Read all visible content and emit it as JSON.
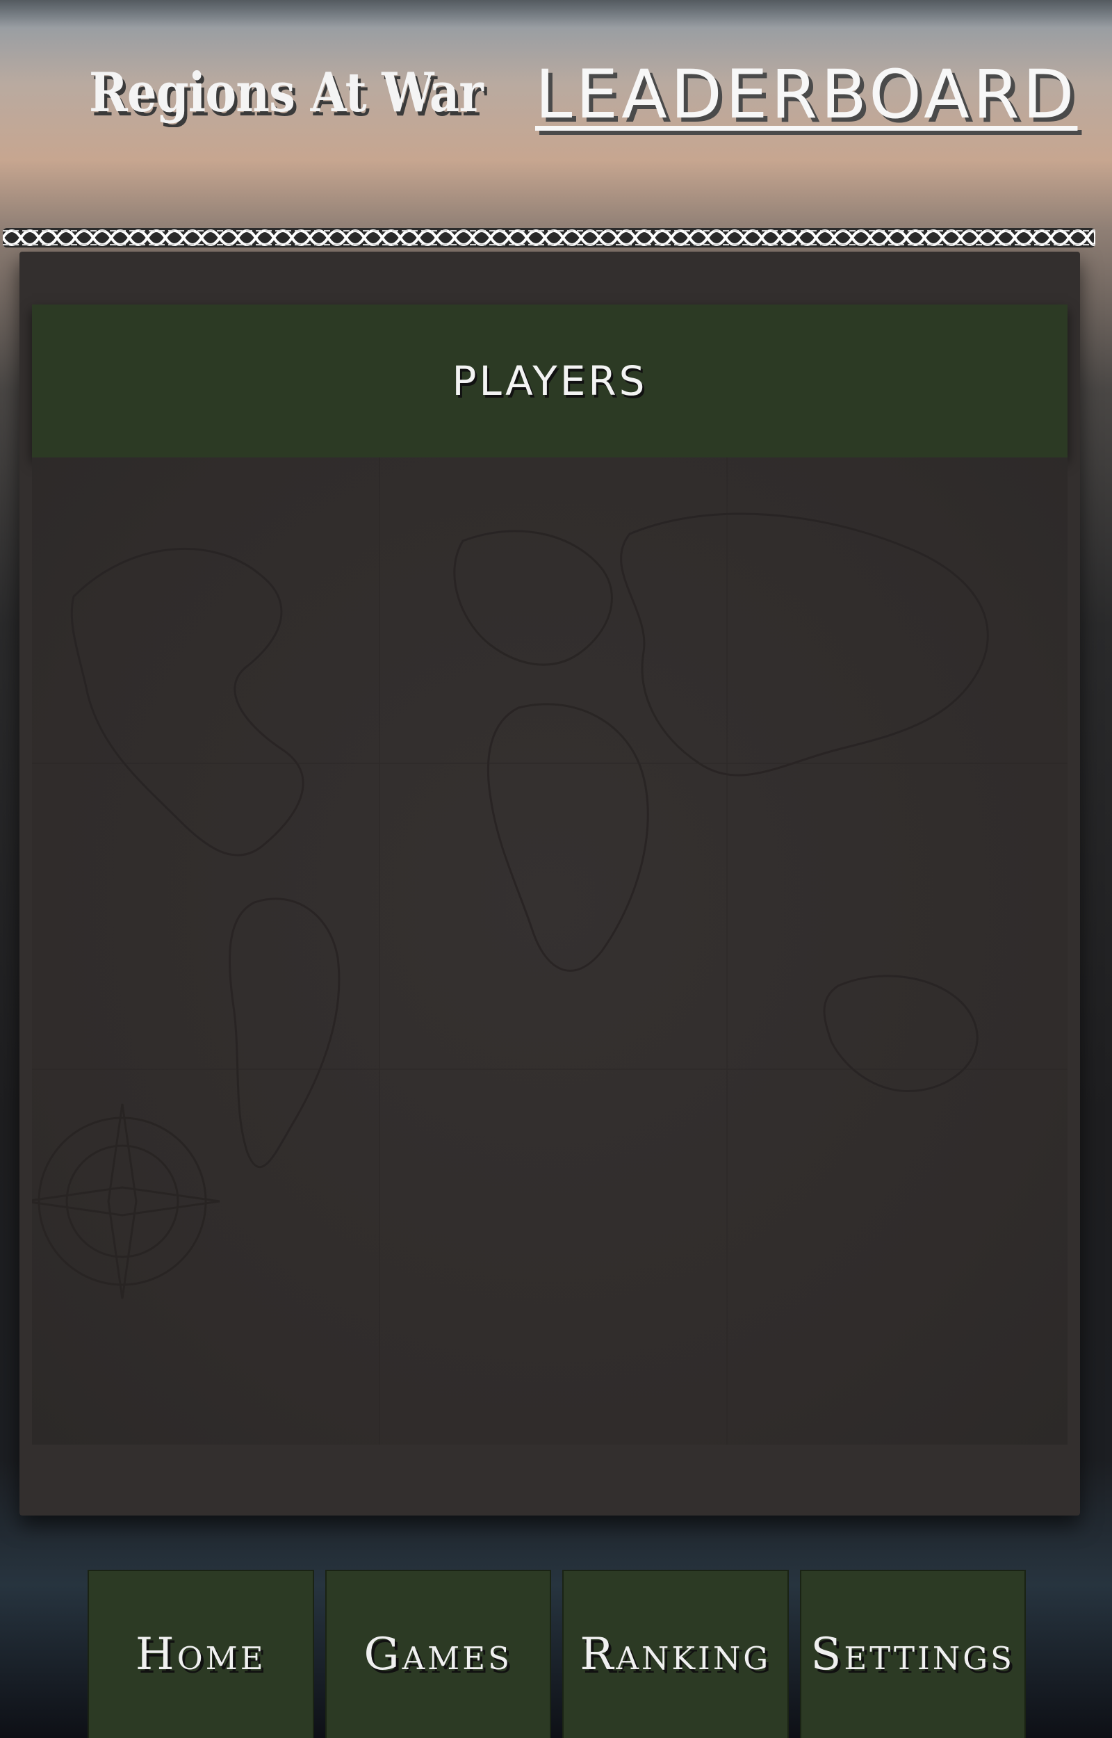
{
  "header": {
    "brand": "Regions At War",
    "title": "LEADERBOARD"
  },
  "panel": {
    "section_title": "PLAYERS"
  },
  "nav": {
    "items": [
      {
        "label": "Home",
        "icon": "none"
      },
      {
        "label": "Games",
        "icon": "none"
      },
      {
        "label": "Ranking",
        "icon": "none"
      },
      {
        "label": "Settings",
        "icon": "none"
      }
    ]
  },
  "colors": {
    "button_green": "#2c3a24",
    "panel_bg": "#332f2e",
    "text": "#f3f3f3"
  }
}
